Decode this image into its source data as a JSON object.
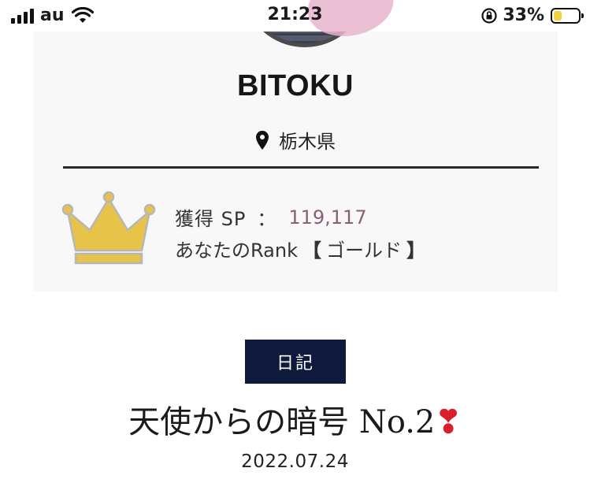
{
  "status_bar": {
    "carrier": "au",
    "time": "21:23",
    "battery_percent": "33%",
    "battery_level": 0.33,
    "battery_color": "#f5d23a",
    "icons": [
      "signal-icon",
      "wifi-icon",
      "orientation-lock-icon",
      "battery-icon"
    ]
  },
  "profile": {
    "username": "BITOKU",
    "location": "栃木県",
    "location_icon": "map-pin-icon",
    "sp_label": "獲得 SP",
    "sp_colon": "：",
    "sp_value": "119,117",
    "rank_prefix": "あなたのRank",
    "rank_open": "【",
    "rank_name": "ゴールド",
    "rank_close": "】",
    "rank_icon": "crown-icon",
    "crown_color": "#e8c34a"
  },
  "post": {
    "category": "日記",
    "title": "天使からの暗号 No.2",
    "title_emoji": "❣",
    "date": "2022.07.24"
  },
  "colors": {
    "badge_bg": "#0f1a3c",
    "highlight": "#f1c8dc"
  }
}
